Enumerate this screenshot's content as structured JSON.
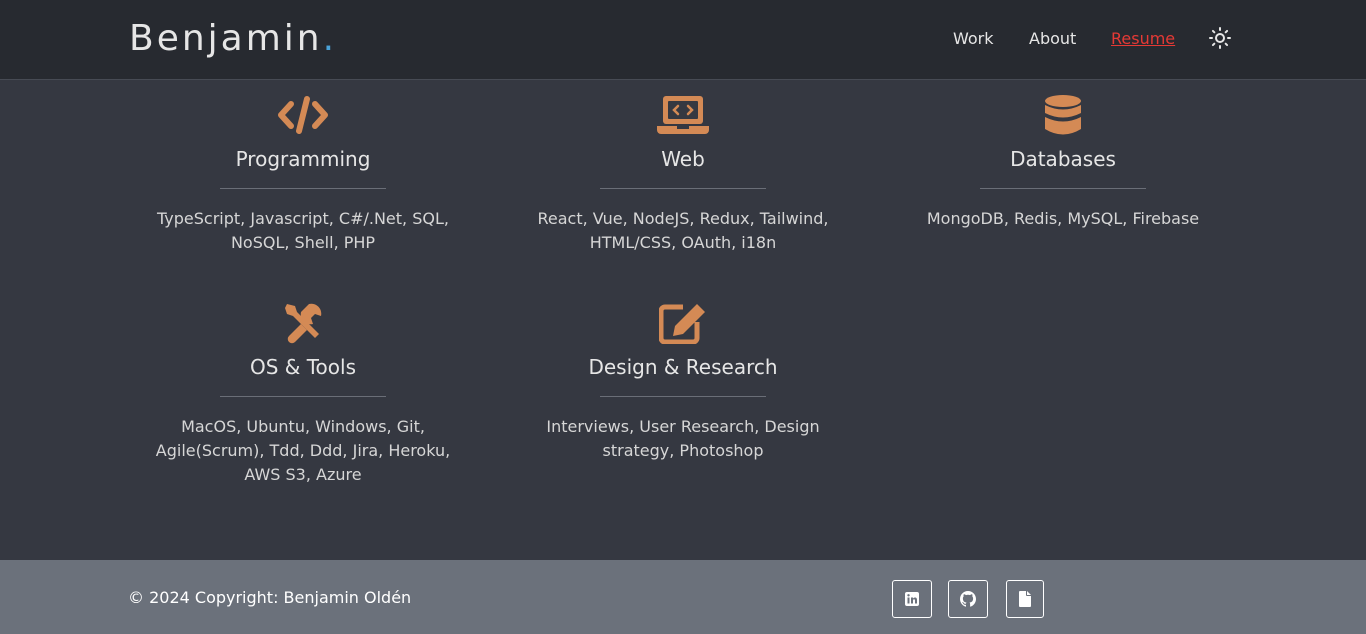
{
  "brand": {
    "name": "Benjamin",
    "dot": "."
  },
  "nav": {
    "links": [
      "Work",
      "About",
      "Resume"
    ],
    "active": "Resume"
  },
  "icons": {
    "theme": "sun-icon",
    "accent_color": "#d48a55"
  },
  "skills": [
    {
      "icon": "code-icon",
      "title": "Programming",
      "desc": "TypeScript, Javascript, C#/.Net, SQL, NoSQL, Shell, PHP"
    },
    {
      "icon": "laptop-code-icon",
      "title": "Web",
      "desc": "React, Vue, NodeJS, Redux, Tailwind, HTML/CSS, OAuth, i18n"
    },
    {
      "icon": "database-icon",
      "title": "Databases",
      "desc": "MongoDB, Redis, MySQL, Firebase"
    },
    {
      "icon": "tools-icon",
      "title": "OS & Tools",
      "desc": "MacOS, Ubuntu, Windows, Git, Agile(Scrum), Tdd, Ddd, Jira, Heroku, AWS S3, Azure"
    },
    {
      "icon": "edit-icon",
      "title": "Design & Research",
      "desc": "Interviews, User Research, Design strategy, Photoshop"
    }
  ],
  "footer": {
    "copyright": "© 2024 Copyright: Benjamin Oldén",
    "social": [
      "linkedin-icon",
      "github-icon",
      "file-icon"
    ]
  }
}
